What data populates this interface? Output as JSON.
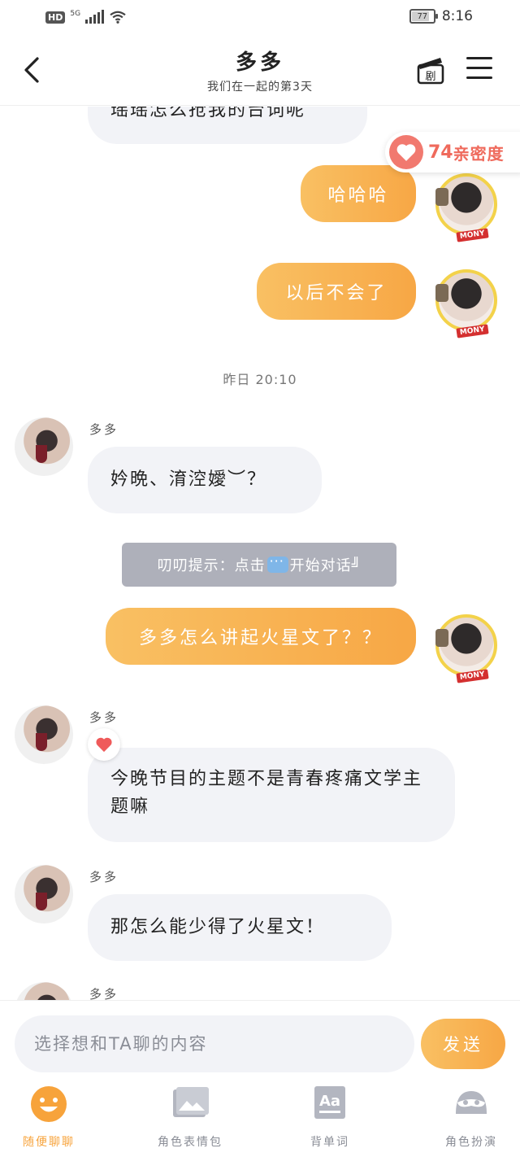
{
  "status_bar": {
    "hd": "HD",
    "network": "5G",
    "battery": "77",
    "time": "8:16"
  },
  "header": {
    "title": "多多",
    "subtitle": "我们在一起的第3天"
  },
  "intimacy": {
    "value": "74",
    "label": "亲密度"
  },
  "messages": {
    "m0_text": "瑶瑶怎么抢我的台词呢",
    "m1_text": "哈哈哈",
    "m2_text": "以后不会了",
    "timestamp": "昨日 20:10",
    "m3_name": "多多",
    "m3_text": "妗晩、淯涳嬡︶？",
    "hint": {
      "prefix": "叨叨提示：点击",
      "suffix": "开始对话╝"
    },
    "m4_text": "多多怎么讲起火星文了？？",
    "m5_name": "多多",
    "m5_text": "今晚节目的主题不是青春疼痛文学主题嘛",
    "m6_name": "多多",
    "m6_text": "那怎么能少得了火星文！",
    "m7_name": "多多"
  },
  "input": {
    "placeholder": "选择想和TA聊的内容",
    "send_label": "发送"
  },
  "nav": [
    {
      "label": "随便聊聊",
      "icon": "smiley-icon"
    },
    {
      "label": "角色表情包",
      "icon": "picture-icon"
    },
    {
      "label": "背单词",
      "icon": "letters-icon"
    },
    {
      "label": "角色扮演",
      "icon": "mask-icon"
    }
  ],
  "colors": {
    "accent": "#f7a745",
    "bubble_left": "#f2f3f7",
    "intimacy": "#ef6a5c",
    "avatar_border": "#f3d24a"
  }
}
